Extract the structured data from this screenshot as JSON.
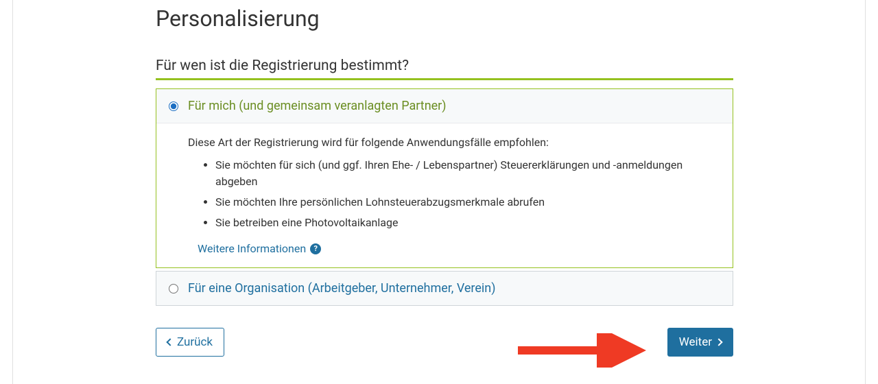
{
  "page": {
    "heading": "Personalisierung",
    "section_heading": "Für wen ist die Registrierung bestimmt?"
  },
  "options": {
    "self": {
      "label": "Für mich (und gemeinsam veranlagten Partner)",
      "intro": "Diese Art der Registrierung wird für folgende Anwendungsfälle empfohlen:",
      "bullets": [
        "Sie möchten für sich (und ggf. Ihren Ehe- / Lebenspartner) Steuererklärungen und -anmeldungen abgeben",
        "Sie möchten Ihre persönlichen Lohnsteuerabzugsmerkmale abrufen",
        "Sie betreiben eine Photovoltaikanlage"
      ],
      "more_info_label": "Weitere Informationen"
    },
    "org": {
      "label": "Für eine Organisation (Arbeitgeber, Unternehmer, Verein)"
    }
  },
  "buttons": {
    "back": "Zurück",
    "next": "Weiter"
  }
}
